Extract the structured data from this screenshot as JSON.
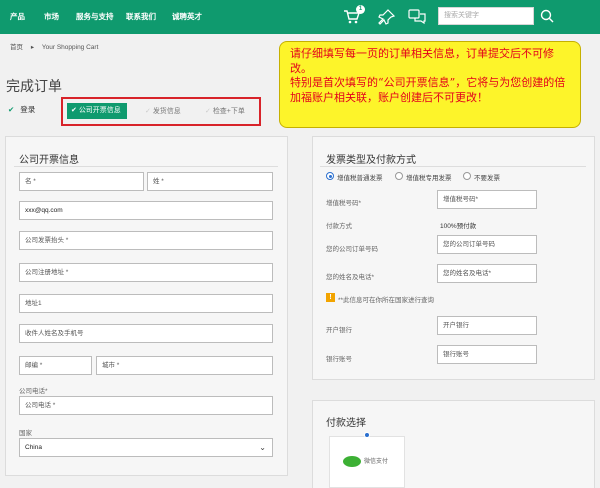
{
  "nav": {
    "items": [
      "产品",
      "市场",
      "服务与支持",
      "联系我们",
      "诚聘英才"
    ],
    "cart_count": "1",
    "search_placeholder": "搜索关键字"
  },
  "breadcrumb": {
    "home": "首页",
    "current": "Your Shopping Cart"
  },
  "page_title": "完成订单",
  "steps": [
    {
      "label": "登录",
      "state": "done"
    },
    {
      "label": "公司开票信息",
      "state": "active"
    },
    {
      "label": "发货信息",
      "state": "todo"
    },
    {
      "label": "检查+下单",
      "state": "todo"
    }
  ],
  "note": {
    "line1": "请仔细填写每一页的订单相关信息，订单提交后不可修改。",
    "line2": "特别是首次填写的“公司开票信息”，它将与为您创建的倍加福账户相关联，账户创建后不可更改！"
  },
  "left_panel": {
    "title": "公司开票信息",
    "first_name": "名 *",
    "last_name": "姓 *",
    "email": "xxx@qq.com",
    "company_title": "公司发票抬头 *",
    "company_address": "公司注册地址 *",
    "address1": "地址1",
    "recipient": "收件人姓名及手机号",
    "postcode": "邮编 *",
    "city": "城市 *",
    "phone_label": "公司电话*",
    "phone": "公司电话 *",
    "country_label": "国家",
    "country": "China"
  },
  "right_panel": {
    "title": "发票类型及付款方式",
    "invoice_types": [
      {
        "label": "增值税普通发票",
        "selected": true
      },
      {
        "label": "增值税专用发票",
        "selected": false
      },
      {
        "label": "不要发票",
        "selected": false
      }
    ],
    "tax_label": "增值税号码*",
    "tax_placeholder": "增值税号码*",
    "payment_method_label": "付款方式",
    "payment_method_value": "100%预付款",
    "po_label": "您的公司订单号码",
    "po_placeholder": "您的公司订单号码",
    "name_phone_label": "您的姓名及电话*",
    "name_phone_placeholder": "您的姓名及电话*",
    "notice": "**此信息可在你所在国家进行查询",
    "bank_label": "开户银行",
    "bank_placeholder": "开户银行",
    "account_label": "银行账号",
    "account_placeholder": "银行账号"
  },
  "payment": {
    "title": "付款选择",
    "option": "微信支付"
  },
  "colors": {
    "brand_green": "#0f9a6e",
    "highlight_red": "#d8232a",
    "note_yellow": "#fdf42a"
  }
}
